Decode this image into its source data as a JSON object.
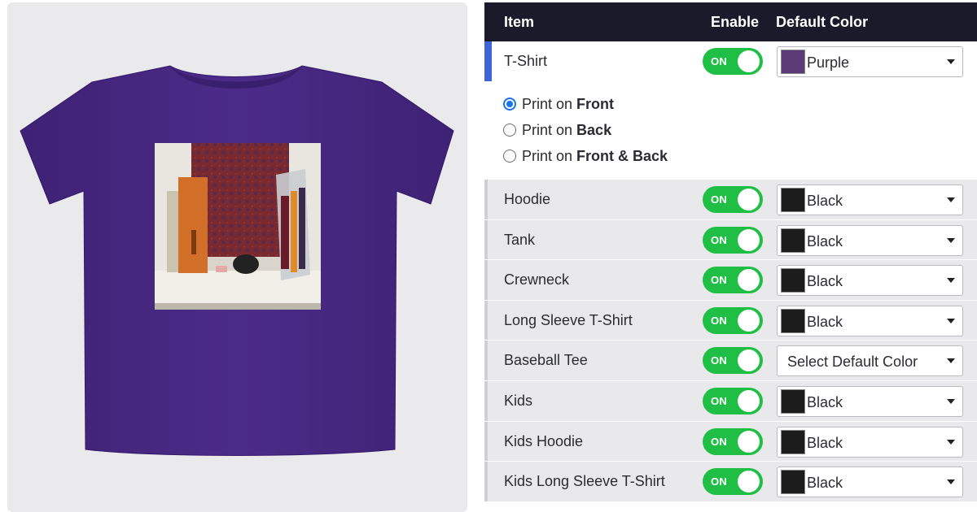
{
  "preview": {
    "shirt_color": "#4a2a86",
    "art_description_icon": "altar-photo-art"
  },
  "table": {
    "headers": {
      "item": "Item",
      "enable": "Enable",
      "default_color": "Default Color"
    },
    "active_row": {
      "label": "T-Shirt",
      "toggle": "ON",
      "color": {
        "name": "Purple",
        "hex": "#5c3a78"
      }
    },
    "print_options": [
      {
        "prefix": "Print on ",
        "bold": "Front",
        "checked": true
      },
      {
        "prefix": "Print on ",
        "bold": "Back",
        "checked": false
      },
      {
        "prefix": "Print on ",
        "bold": "Front & Back",
        "checked": false
      }
    ],
    "rows": [
      {
        "label": "Hoodie",
        "toggle": "ON",
        "color": "Black",
        "hex": "#1c1c1c"
      },
      {
        "label": "Tank",
        "toggle": "ON",
        "color": "Black",
        "hex": "#1c1c1c"
      },
      {
        "label": "Crewneck",
        "toggle": "ON",
        "color": "Black",
        "hex": "#1c1c1c"
      },
      {
        "label": "Long Sleeve T-Shirt",
        "toggle": "ON",
        "color": "Black",
        "hex": "#1c1c1c"
      },
      {
        "label": "Baseball Tee",
        "toggle": "ON",
        "color": "Select Default Color",
        "hex": ""
      },
      {
        "label": "Kids",
        "toggle": "ON",
        "color": "Black",
        "hex": "#1c1c1c"
      },
      {
        "label": "Kids Hoodie",
        "toggle": "ON",
        "color": "Black",
        "hex": "#1c1c1c"
      },
      {
        "label": "Kids Long Sleeve T-Shirt",
        "toggle": "ON",
        "color": "Black",
        "hex": "#1c1c1c"
      }
    ]
  },
  "colors": {
    "header_bg": "#1b1a2b",
    "toggle_on": "#1fbf46",
    "active_bar": "#3f63d8",
    "radio_accent": "#1a73e8"
  }
}
